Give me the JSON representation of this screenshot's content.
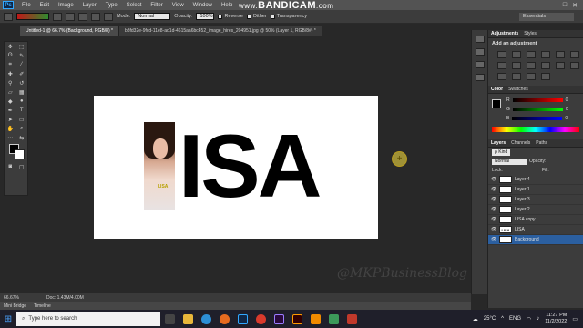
{
  "menubar": {
    "app_icon": "Ps",
    "items": [
      "File",
      "Edit",
      "Image",
      "Layer",
      "Type",
      "Select",
      "Filter",
      "View",
      "Window",
      "Help"
    ],
    "win_min": "–",
    "win_max": "□",
    "win_close": "✕"
  },
  "overlay": {
    "bandicam_prefix": "www.",
    "bandicam_name": "BANDICAM",
    "bandicam_suffix": ".com"
  },
  "options_bar": {
    "mode_label": "Mode:",
    "mode_value": "Normal",
    "opacity_label": "Opacity:",
    "opacity_value": "100%",
    "reverse_label": "Reverse",
    "dither_label": "Dither",
    "transparency_label": "Transparency",
    "workspace_value": "Essentials"
  },
  "tabs": [
    {
      "label": "Untitled-1 @ 66.7% (Background, RGB/8) *"
    },
    {
      "label": "b8fd32e-9fcd-11e8-ad1d-4615aa6bc452_image_hires_204951.jpg @ 50% (Layer 1, RGB/8#) *"
    }
  ],
  "canvas": {
    "title_text": "ISA",
    "photo_label": "LISA"
  },
  "status": {
    "zoom": "66.67%",
    "doc": "Doc: 1.43M/4.00M"
  },
  "bottom_tabs": {
    "mini_bridge": "Mini Bridge",
    "timeline": "Timeline"
  },
  "watermark": "@MKPBusinessBlog",
  "panels": {
    "adjust_tabs": [
      "Adjustments",
      "Styles"
    ],
    "adjust_sub": "Add an adjustment",
    "color_tabs": [
      "Color",
      "Swatches"
    ],
    "color_rows": [
      {
        "label": "R",
        "value": "0"
      },
      {
        "label": "G",
        "value": "0"
      },
      {
        "label": "B",
        "value": "0"
      }
    ],
    "layers_tabs": [
      "Layers",
      "Channels",
      "Paths"
    ],
    "kind_label": "ρ Kind",
    "blend_mode": "Normal",
    "opacity_label": "Opacity:",
    "lock_label": "Lock:",
    "fill_label": "Fill:",
    "layers": [
      {
        "name": "Layer 4",
        "thumb": ""
      },
      {
        "name": "Layer 1",
        "thumb": ""
      },
      {
        "name": "Layer 3",
        "thumb": ""
      },
      {
        "name": "Layer 2",
        "thumb": ""
      },
      {
        "name": "LISA copy",
        "thumb": ""
      },
      {
        "name": "LISA",
        "thumb": "LISA"
      },
      {
        "name": "Background",
        "thumb": ""
      }
    ]
  },
  "taskbar": {
    "search_placeholder": "Type here to search",
    "temperature": "25°C",
    "lang": "ENG",
    "time": "11:27 PM",
    "date": "11/2/2022"
  }
}
